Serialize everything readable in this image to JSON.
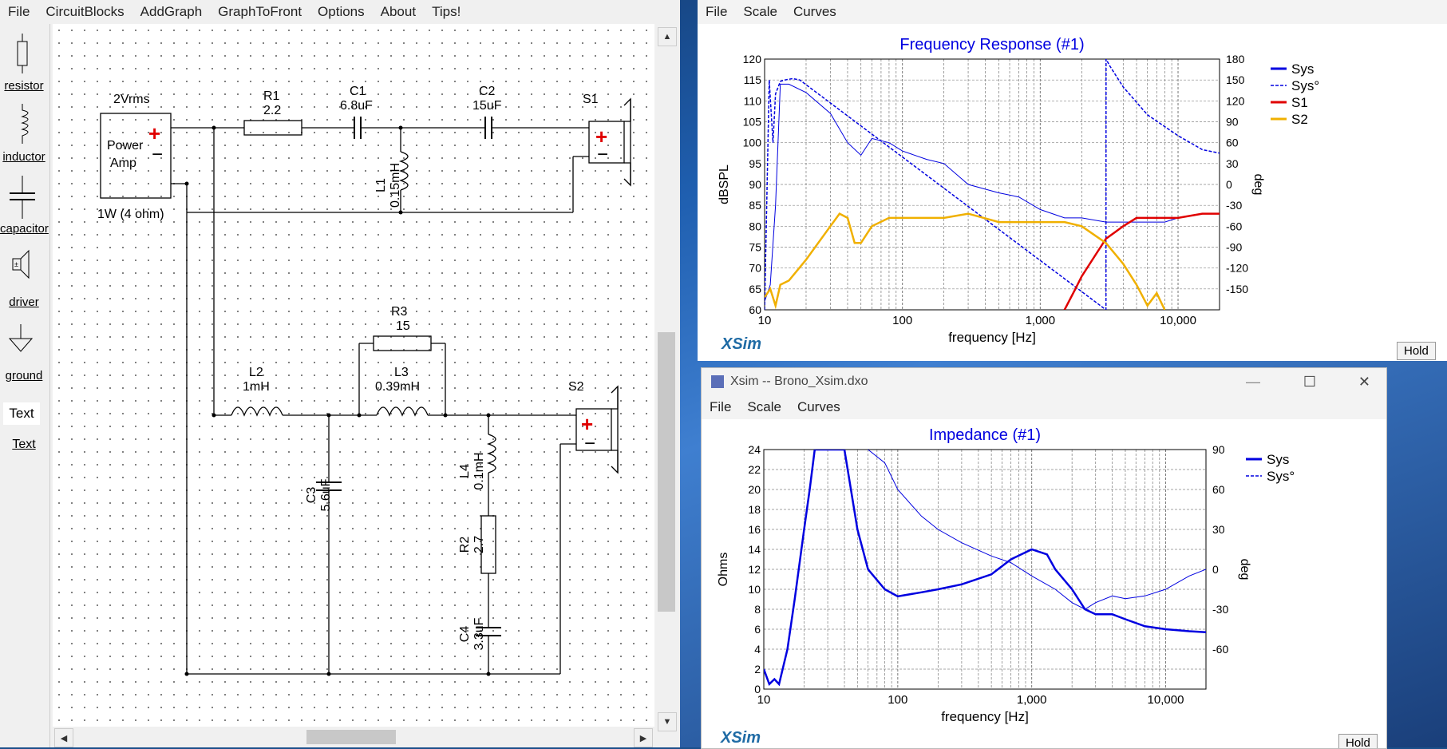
{
  "schematic": {
    "menu": [
      "File",
      "CircuitBlocks",
      "AddGraph",
      "GraphToFront",
      "Options",
      "About",
      "Tips!"
    ],
    "tools": [
      {
        "label": "resistor",
        "icon": "resistor-icon"
      },
      {
        "label": "inductor",
        "icon": "inductor-icon"
      },
      {
        "label": "capacitor",
        "icon": "capacitor-icon"
      },
      {
        "label": "driver",
        "icon": "driver-icon"
      },
      {
        "label": "ground",
        "icon": "ground-icon"
      },
      {
        "label": "Text",
        "icon": "text-icon"
      }
    ],
    "text_tool_glyph": "Text",
    "source": {
      "voltage": "2Vrms",
      "label1": "Power",
      "label2": "Amp",
      "power": "1W (4 ohm)"
    },
    "components": {
      "R1": {
        "name": "R1",
        "value": "2.2"
      },
      "C1": {
        "name": "C1",
        "value": "6.8uF"
      },
      "C2": {
        "name": "C2",
        "value": "15uF"
      },
      "L1": {
        "name": "L1",
        "value": "0.15mH"
      },
      "S1": {
        "name": "S1"
      },
      "R3": {
        "name": "R3",
        "value": "15"
      },
      "L2": {
        "name": "L2",
        "value": "1mH"
      },
      "L3": {
        "name": "L3",
        "value": "0.39mH"
      },
      "S2": {
        "name": "S2"
      },
      "C3": {
        "name": "C3",
        "value": "5.6uF"
      },
      "L4": {
        "name": "L4",
        "value": "0.1mH"
      },
      "R2": {
        "name": "R2",
        "value": "2.7"
      },
      "C4": {
        "name": "C4",
        "value": "3.3uF"
      }
    },
    "plus": "+",
    "minus": "−"
  },
  "fr_window": {
    "menu": [
      "File",
      "Scale",
      "Curves"
    ],
    "hold": "Hold",
    "logo": "XSim",
    "chart_data": {
      "type": "line",
      "title": "Frequency Response (#1)",
      "xlabel": "frequency [Hz]",
      "ylabel": "dBSPL",
      "y2label": "deg",
      "x_scale": "log",
      "xlim": [
        10,
        20000
      ],
      "ylim": [
        60,
        120
      ],
      "y2lim": [
        -180,
        180
      ],
      "x_ticks": [
        "10",
        "100",
        "1,000",
        "10,000"
      ],
      "y_ticks": [
        "120",
        "115",
        "110",
        "105",
        "100",
        "95",
        "90",
        "85",
        "80",
        "75",
        "70",
        "65",
        "60"
      ],
      "y2_ticks": [
        "180",
        "150",
        "120",
        "90",
        "60",
        "30",
        "0",
        "-30",
        "-60",
        "-90",
        "-120",
        "-150"
      ],
      "legend_position": "right",
      "colors": {
        "Sys": "#0000e0",
        "S1": "#e00000",
        "S2": "#f0b000"
      },
      "series": [
        {
          "name": "Sys",
          "style": "solid",
          "x": [
            10,
            11,
            12,
            13,
            15,
            20,
            30,
            40,
            50,
            60,
            80,
            100,
            150,
            200,
            300,
            500,
            700,
            1000,
            1500,
            2000,
            3000,
            5000,
            8000,
            10000,
            15000,
            20000
          ],
          "y": [
            62,
            66,
            85,
            114,
            114,
            112,
            107,
            100,
            97,
            101,
            100,
            98,
            96,
            95,
            90,
            88,
            87,
            84,
            82,
            82,
            81,
            81,
            81,
            82,
            83,
            83
          ]
        },
        {
          "name": "Sys°",
          "style": "dashed",
          "x": [
            10,
            10.8,
            11.5,
            12,
            13,
            14,
            16,
            18,
            3000,
            3001,
            3200,
            4000,
            6000,
            10000,
            15000,
            20000
          ],
          "y": [
            -180,
            150,
            60,
            130,
            148,
            150,
            152,
            150,
            -180,
            180,
            170,
            140,
            100,
            70,
            50,
            45
          ]
        },
        {
          "name": "S1",
          "style": "solid",
          "x": [
            1500,
            1800,
            2000,
            2500,
            3000,
            4000,
            5000,
            7000,
            10000,
            15000,
            20000
          ],
          "y": [
            60,
            65,
            68,
            73,
            77,
            80,
            82,
            82,
            82,
            83,
            83
          ]
        },
        {
          "name": "S2",
          "style": "solid",
          "x": [
            10,
            11,
            12,
            13,
            15,
            20,
            30,
            35,
            40,
            45,
            50,
            60,
            80,
            100,
            150,
            200,
            300,
            500,
            700,
            1000,
            1500,
            2000,
            3000,
            4000,
            5000,
            6000,
            7000,
            8000
          ],
          "y": [
            63,
            65,
            61,
            66,
            67,
            72,
            80,
            83,
            82,
            76,
            76,
            80,
            82,
            82,
            82,
            82,
            83,
            81,
            81,
            81,
            81,
            80,
            76,
            71,
            66,
            61,
            64,
            60
          ]
        }
      ]
    }
  },
  "z_window": {
    "title": "Xsim -- Brono_Xsim.dxo",
    "menu": [
      "File",
      "Scale",
      "Curves"
    ],
    "hold": "Hold",
    "logo": "XSim",
    "window_buttons": {
      "minimize": "—",
      "maximize": "☐",
      "close": "✕"
    },
    "chart_data": {
      "type": "line",
      "title": "Impedance (#1)",
      "xlabel": "frequency [Hz]",
      "ylabel": "Ohms",
      "y2label": "deg",
      "x_scale": "log",
      "xlim": [
        10,
        20000
      ],
      "ylim": [
        0,
        24
      ],
      "y2lim": [
        -90,
        90
      ],
      "x_ticks": [
        "10",
        "100",
        "1,000",
        "10,000"
      ],
      "y_ticks": [
        "24",
        "22",
        "20",
        "18",
        "16",
        "14",
        "12",
        "10",
        "8",
        "6",
        "4",
        "2",
        "0"
      ],
      "y2_ticks": [
        "90",
        "60",
        "30",
        "0",
        "-30",
        "-60"
      ],
      "legend_position": "top-right",
      "series": [
        {
          "name": "Sys",
          "style": "solid",
          "x": [
            10,
            11,
            12,
            13,
            15,
            17,
            20,
            22,
            24,
            40,
            50,
            60,
            80,
            100,
            150,
            200,
            300,
            500,
            700,
            1000,
            1300,
            1500,
            2000,
            2500,
            3000,
            4000,
            5000,
            7000,
            10000,
            15000,
            20000
          ],
          "y": [
            2,
            0.5,
            1,
            0.5,
            4,
            9,
            16,
            20,
            24,
            24,
            16,
            12,
            10,
            9.3,
            9.7,
            10,
            10.5,
            11.5,
            13,
            14,
            13.5,
            12,
            10,
            8,
            7.5,
            7.5,
            7,
            6.3,
            6,
            5.8,
            5.7
          ]
        },
        {
          "name": "Sys°",
          "style": "thin",
          "x": [
            60,
            80,
            100,
            150,
            200,
            300,
            500,
            700,
            1000,
            1500,
            2000,
            2500,
            3000,
            4000,
            5000,
            7000,
            10000,
            15000,
            20000
          ],
          "y": [
            90,
            80,
            60,
            40,
            30,
            20,
            10,
            5,
            -5,
            -15,
            -25,
            -30,
            -25,
            -20,
            -22,
            -20,
            -15,
            -5,
            0
          ]
        }
      ]
    }
  }
}
